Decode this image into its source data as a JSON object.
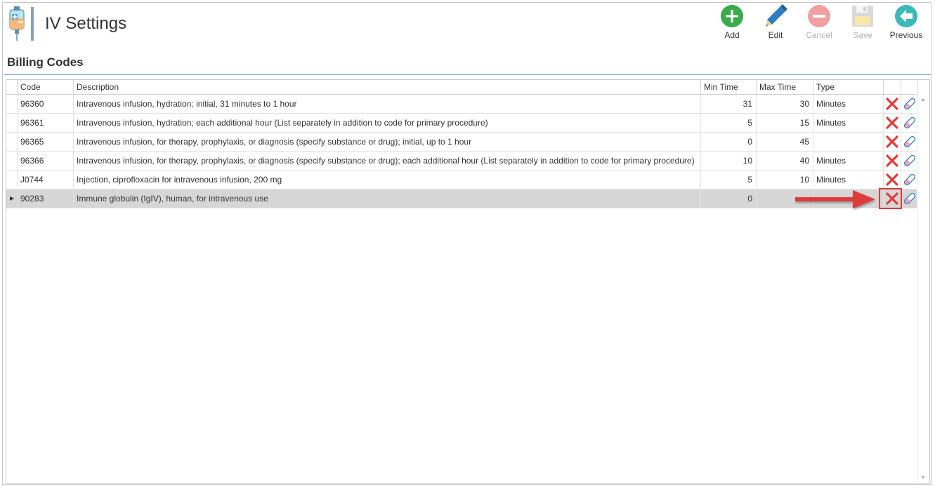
{
  "window": {
    "title": "IV Settings"
  },
  "toolbar": {
    "add_label": "Add",
    "edit_label": "Edit",
    "cancel_label": "Cancel",
    "save_label": "Save",
    "previous_label": "Previous"
  },
  "section": {
    "title": "Billing Codes"
  },
  "grid": {
    "columns": {
      "code": "Code",
      "description": "Description",
      "min_time": "Min Time",
      "max_time": "Max Time",
      "type": "Type"
    },
    "rows": [
      {
        "code": "96360",
        "description": "Intravenous infusion, hydration; initial, 31 minutes to 1 hour",
        "min_time": "31",
        "max_time": "30",
        "type": "Minutes"
      },
      {
        "code": "96361",
        "description": "Intravenous infusion, hydration; each additional hour (List separately in addition to code for primary procedure)",
        "min_time": "5",
        "max_time": "15",
        "type": "Minutes"
      },
      {
        "code": "96365",
        "description": "Intravenous infusion, for therapy, prophylaxis, or diagnosis (specify substance or drug); initial, up to 1 hour",
        "min_time": "0",
        "max_time": "45",
        "type": ""
      },
      {
        "code": "96366",
        "description": "Intravenous infusion, for therapy, prophylaxis, or diagnosis (specify substance or drug); each additional hour (List separately in addition to code for primary procedure)",
        "min_time": "10",
        "max_time": "40",
        "type": "Minutes"
      },
      {
        "code": "J0744",
        "description": "Injection, ciprofloxacin for intravenous infusion, 200 mg",
        "min_time": "5",
        "max_time": "10",
        "type": "Minutes"
      },
      {
        "code": "90283",
        "description": "Immune globulin (IgIV), human, for intravenous use",
        "min_time": "0",
        "max_time": "",
        "type": ""
      }
    ]
  },
  "icons": {
    "add": "plus-circle-icon",
    "edit": "pencil-icon",
    "cancel": "minus-circle-icon",
    "save": "floppy-disk-icon",
    "previous": "arrow-left-circle-icon",
    "row_delete": "red-x-icon",
    "row_edit": "eraser-icon"
  },
  "colors": {
    "add": "#3aaa4a",
    "edit": "#2f7cc1",
    "cancel_disabled": "#f0a0a0",
    "previous": "#3cb8b8",
    "delete": "#e23a3a",
    "annotation": "#e03a3a",
    "selected_row": "#d6d6d6"
  }
}
